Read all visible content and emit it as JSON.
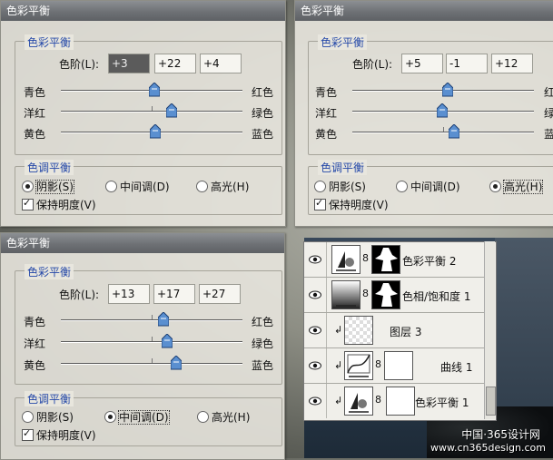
{
  "dialogs": [
    {
      "title": "色彩平衡",
      "balance_group": "色彩平衡",
      "levels_label": "色阶(L):",
      "levels": [
        "+3",
        "+22",
        "+4"
      ],
      "sliders": [
        {
          "left": "青色",
          "right": "红色",
          "value": 3
        },
        {
          "left": "洋红",
          "right": "绿色",
          "value": 22
        },
        {
          "left": "黄色",
          "right": "蓝色",
          "value": 4
        }
      ],
      "tone_group": "色调平衡",
      "tones": [
        {
          "label": "阴影(S)",
          "checked": true
        },
        {
          "label": "中间调(D)",
          "checked": false
        },
        {
          "label": "高光(H)",
          "checked": false
        }
      ],
      "preserve": "保持明度(V)"
    },
    {
      "title": "色彩平衡",
      "balance_group": "色彩平衡",
      "levels_label": "色阶(L):",
      "levels": [
        "+5",
        "-1",
        "+12"
      ],
      "sliders": [
        {
          "left": "青色",
          "right": "红",
          "value": 5
        },
        {
          "left": "洋红",
          "right": "绿",
          "value": -1
        },
        {
          "left": "黄色",
          "right": "蓝",
          "value": 12
        }
      ],
      "tone_group": "色调平衡",
      "tones": [
        {
          "label": "阴影(S)",
          "checked": false
        },
        {
          "label": "中间调(D)",
          "checked": false
        },
        {
          "label": "高光(H)",
          "checked": true
        }
      ],
      "preserve": "保持明度(V)"
    },
    {
      "title": "色彩平衡",
      "balance_group": "色彩平衡",
      "levels_label": "色阶(L):",
      "levels": [
        "+13",
        "+17",
        "+27"
      ],
      "sliders": [
        {
          "left": "青色",
          "right": "红色",
          "value": 13
        },
        {
          "left": "洋红",
          "right": "绿色",
          "value": 17
        },
        {
          "left": "黄色",
          "right": "蓝色",
          "value": 27
        }
      ],
      "tone_group": "色调平衡",
      "tones": [
        {
          "label": "阴影(S)",
          "checked": false
        },
        {
          "label": "中间调(D)",
          "checked": true
        },
        {
          "label": "高光(H)",
          "checked": false
        }
      ],
      "preserve": "保持明度(V)"
    }
  ],
  "layers": [
    {
      "name": "色彩平衡 2",
      "kind": "adjustment-with-mask"
    },
    {
      "name": "色相/饱和度 1",
      "kind": "adjustment-with-mask"
    },
    {
      "name": "图层 3",
      "kind": "clipped-transparent"
    },
    {
      "name": "曲线 1",
      "kind": "clipped-adjustment"
    },
    {
      "name": "色彩平衡 1",
      "kind": "clipped-adjustment"
    }
  ],
  "watermark": {
    "line1": "中国·365设计网",
    "line2": "www.cn365design.com"
  }
}
